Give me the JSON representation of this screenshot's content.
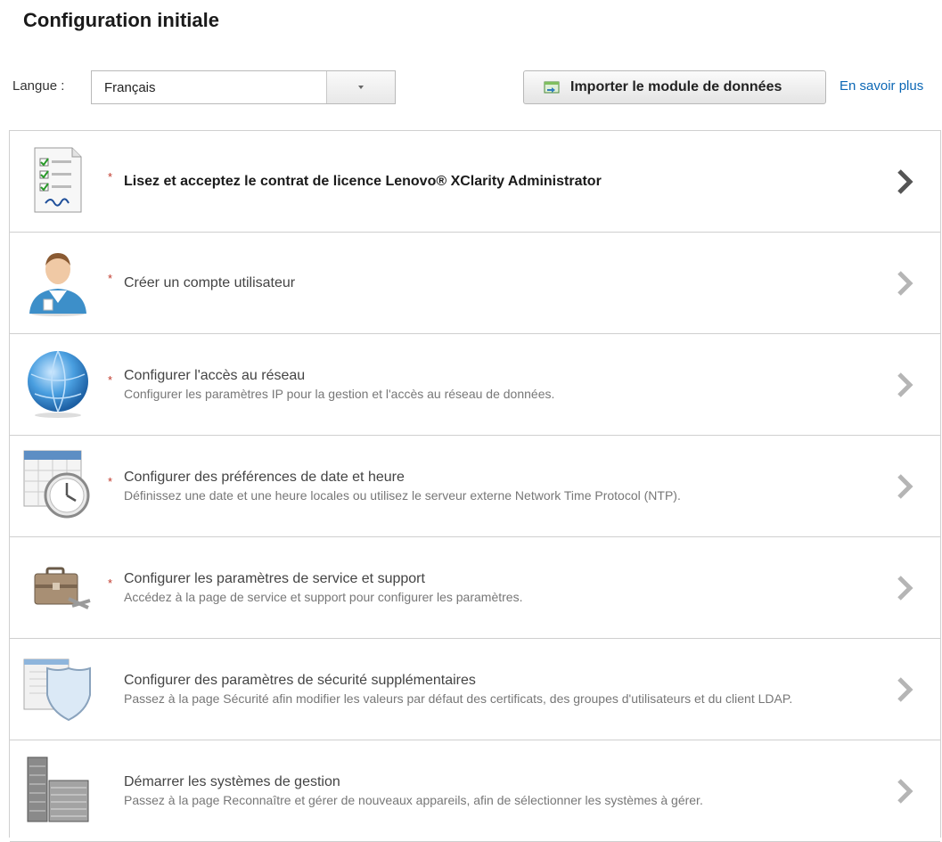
{
  "page": {
    "title": "Configuration initiale"
  },
  "toolbar": {
    "language_label": "Langue :",
    "language_value": "Français",
    "import_label": "Importer le module de données",
    "learn_more": "En savoir plus"
  },
  "steps": [
    {
      "title": "Lisez et acceptez le contrat de licence Lenovo® XClarity Administrator",
      "desc": "",
      "required": true,
      "icon": "license-document-icon"
    },
    {
      "title": "Créer un compte utilisateur",
      "desc": "",
      "required": true,
      "icon": "user-account-icon"
    },
    {
      "title": "Configurer l'accès au réseau",
      "desc": "Configurer les paramètres IP pour la gestion et l'accès au réseau de données.",
      "required": true,
      "icon": "network-globe-icon"
    },
    {
      "title": "Configurer des préférences de date et heure",
      "desc": "Définissez une date et une heure locales ou utilisez le serveur externe Network Time Protocol (NTP).",
      "required": true,
      "icon": "calendar-clock-icon"
    },
    {
      "title": "Configurer les paramètres de service et support",
      "desc": "Accédez à la page de service et support pour configurer les paramètres.",
      "required": true,
      "icon": "briefcase-tools-icon"
    },
    {
      "title": "Configurer des paramètres de sécurité supplémentaires",
      "desc": "Passez à la page Sécurité afin modifier les valeurs par défaut des certificats, des groupes d'utilisateurs et du client LDAP.",
      "required": false,
      "icon": "security-shield-icon"
    },
    {
      "title": "Démarrer les systèmes de gestion",
      "desc": "Passez à la page Reconnaître et gérer de nouveaux appareils, afin de sélectionner les systèmes à gérer.",
      "required": false,
      "icon": "server-rack-icon"
    }
  ],
  "colors": {
    "required_star": "#c0392b",
    "link": "#0b67b5"
  },
  "required_marker": "*"
}
